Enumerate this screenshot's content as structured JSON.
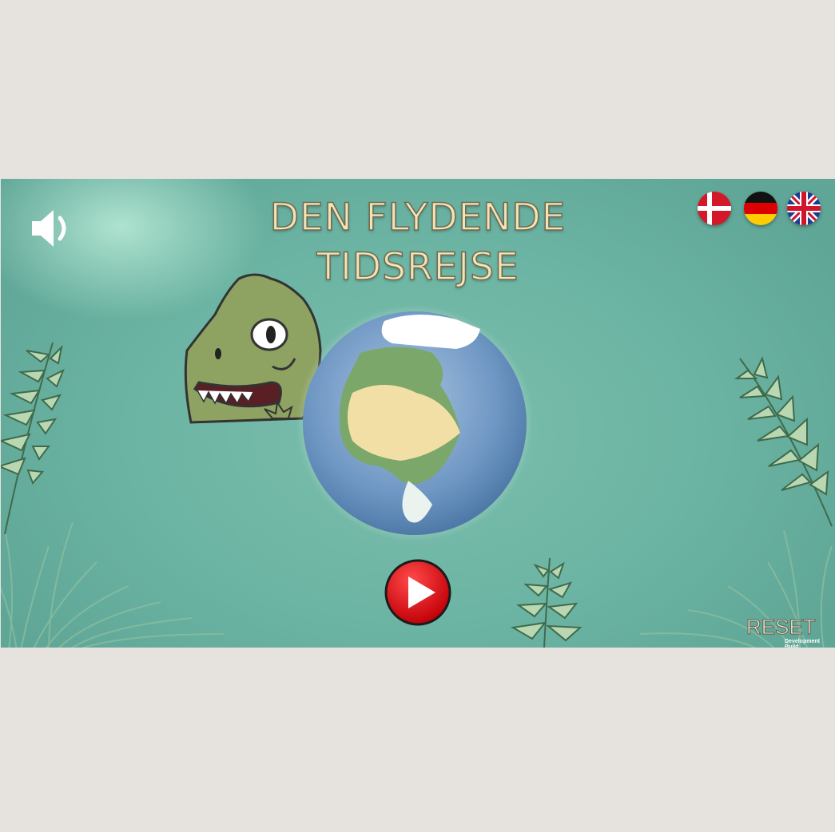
{
  "title": {
    "line1": "DEN FLYDENDE",
    "line2": "TIDSREJSE"
  },
  "sound": {
    "icon": "speaker-icon",
    "state": "on"
  },
  "languages": [
    {
      "code": "da",
      "icon": "danish-flag-icon"
    },
    {
      "code": "de",
      "icon": "german-flag-icon"
    },
    {
      "code": "en",
      "icon": "uk-flag-icon"
    }
  ],
  "play": {
    "icon": "play-icon"
  },
  "reset": {
    "label": "RESET"
  },
  "build": {
    "label": "Development Build"
  },
  "colors": {
    "background": "#6cb4a3",
    "title_fill": "#f3e4b4",
    "dino_green": "#8ea261",
    "ocean": "#6f97c4",
    "land": "#7ba76a",
    "desert": "#f2dfa6",
    "play_red": "#e00f15"
  }
}
